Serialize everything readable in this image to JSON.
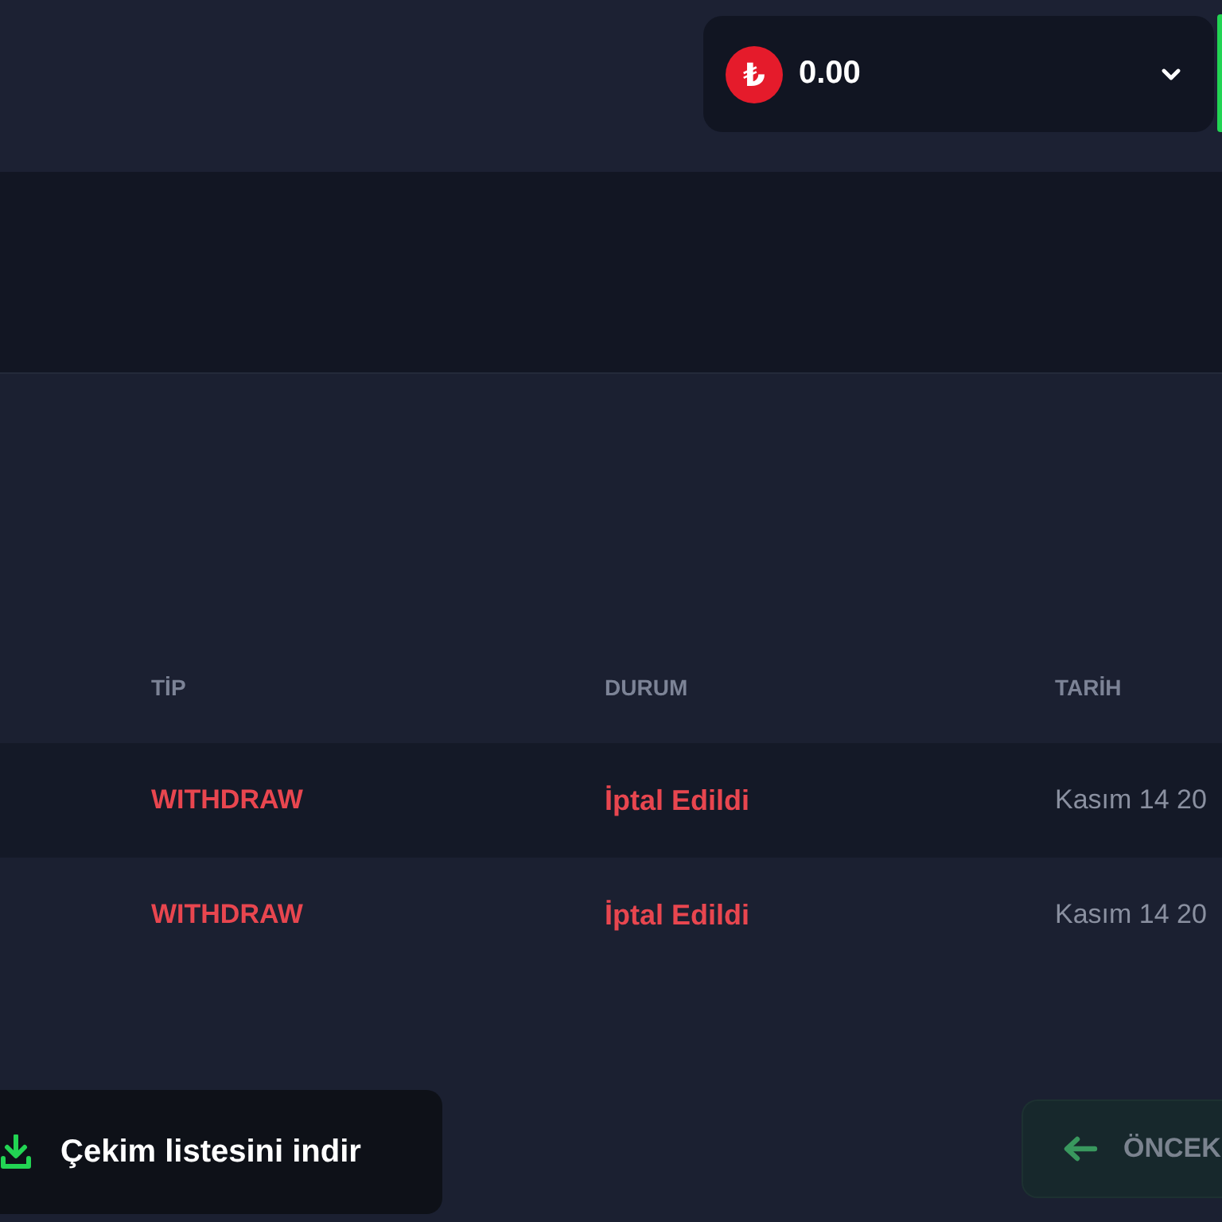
{
  "balance": {
    "currency_symbol": "₺",
    "amount": "0.00"
  },
  "table": {
    "columns": [
      "TİP",
      "DURUM",
      "TARİH"
    ],
    "rows": [
      {
        "type": "WITHDRAW",
        "status": "İptal Edildi",
        "date": "Kasım 14 20"
      },
      {
        "type": "WITHDRAW",
        "status": "İptal Edildi",
        "date": "Kasım 14 20"
      }
    ]
  },
  "download_button": {
    "label": "Çekim listesini indir"
  },
  "pagination": {
    "previous": {
      "label": "ÖNCEK",
      "disabled": true
    }
  }
}
